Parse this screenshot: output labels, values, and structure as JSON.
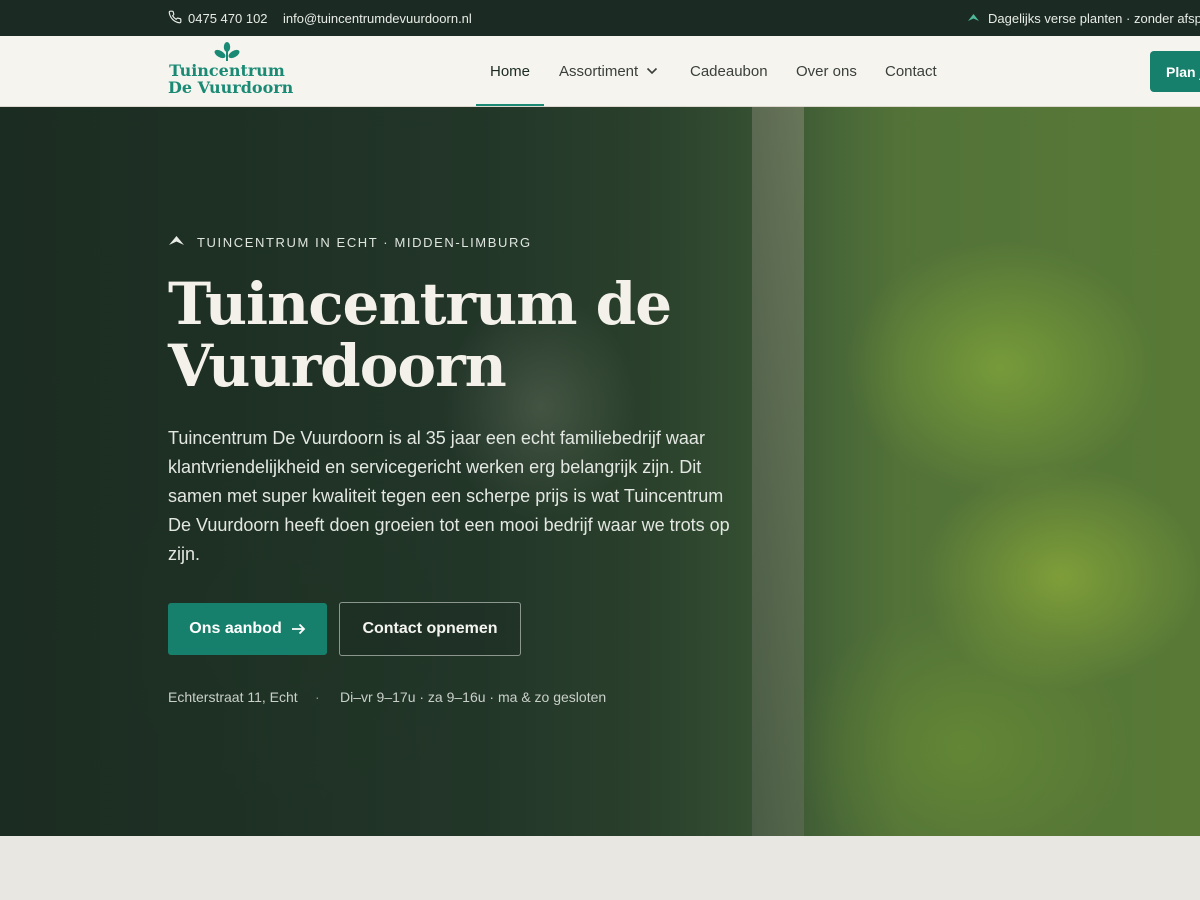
{
  "topbar": {
    "phone": "0475 470 102",
    "email": "info@tuincentrumdevuurdoorn.nl",
    "promo": "Dagelijks verse planten · zonder afspraak welkom"
  },
  "header": {
    "logo_line1": "Tuincentrum",
    "logo_line2": "De Vuurdoorn",
    "nav": {
      "home": "Home",
      "assortiment": "Assortiment",
      "cadeaubon": "Cadeaubon",
      "over_ons": "Over ons",
      "contact": "Contact"
    },
    "cta_label": "Plan je bezoek"
  },
  "hero": {
    "eyebrow": "TUINCENTRUM IN ECHT · MIDDEN-LIMBURG",
    "title": "Tuincentrum de Vuurdoorn",
    "text": "Tuincentrum De Vuurdoorn is al 35 jaar een echt familiebedrijf waar klantvriendelijkheid en servicegericht werken erg belangrijk zijn. Dit samen met super kwaliteit tegen een scherpe prijs is wat Tuincentrum De Vuurdoorn heeft doen groeien tot een mooi bedrijf waar we trots op zijn.",
    "primary_button": "Ons aanbod",
    "secondary_button": "Contact opnemen",
    "address": "Echterstraat 11, Echt",
    "separator": "·",
    "hours": "Di–vr 9–17u · za 9–16u · ma & zo gesloten"
  },
  "colors": {
    "brand_green": "#17806c",
    "topbar_bg": "#1b2a22",
    "header_bg": "#f6f4ef"
  }
}
